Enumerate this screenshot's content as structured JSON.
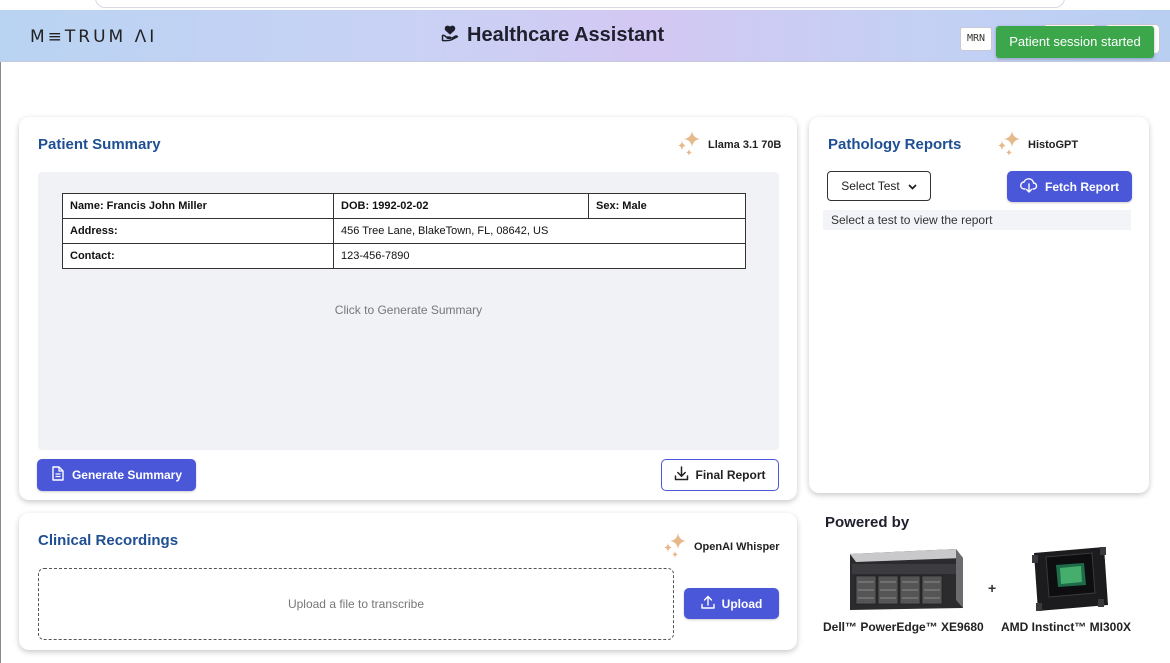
{
  "header": {
    "logo": "M≡TRUM ΛI",
    "title": "Healthcare Assistant",
    "mrn_label": "MRN",
    "toast": "Patient session started",
    "colors": {
      "primary": "#4a57d9",
      "toast": "#3ca64b",
      "title_blue": "#1f4f93",
      "sparkle": "#e6b98c"
    }
  },
  "patient_summary": {
    "title": "Patient Summary",
    "model": "Llama 3.1 70B",
    "name": "Name: Francis John Miller",
    "dob": "DOB: 1992-02-02",
    "sex": "Sex: Male",
    "address_label": "Address:",
    "address_value": "456 Tree Lane, BlakeTown, FL, 08642, US",
    "contact_label": "Contact:",
    "contact_value": "123-456-7890",
    "placeholder": "Click to Generate Summary",
    "generate_button": "Generate Summary",
    "final_report_button": "Final Report"
  },
  "pathology": {
    "title": "Pathology Reports",
    "model": "HistoGPT",
    "select_value": "Select Test",
    "fetch_button": "Fetch Report",
    "message": "Select a test to view the report"
  },
  "recordings": {
    "title": "Clinical Recordings",
    "model": "OpenAI Whisper",
    "upload_placeholder": "Upload a file to transcribe",
    "upload_button": "Upload"
  },
  "powered": {
    "title": "Powered by",
    "hw1": "Dell™ PowerEdge™ XE9680",
    "hw2": "AMD Instinct™ MI300X",
    "plus": "+"
  }
}
